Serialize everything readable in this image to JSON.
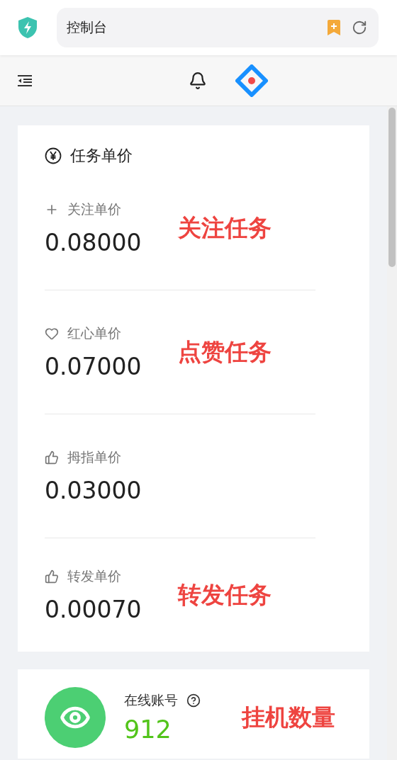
{
  "browser": {
    "address": "控制台"
  },
  "price_card": {
    "title": "任务单价",
    "items": [
      {
        "kind": "plus",
        "label": "关注单价",
        "value": "0.08000",
        "note": "关注任务"
      },
      {
        "kind": "heart",
        "label": "红心单价",
        "value": "0.07000",
        "note": "点赞任务"
      },
      {
        "kind": "thumb",
        "label": "拇指单价",
        "value": "0.03000"
      },
      {
        "kind": "thumb",
        "label": "转发单价",
        "value": "0.00070",
        "note": "转发任务"
      }
    ]
  },
  "online_card": {
    "label": "在线账号",
    "value": "912",
    "note": "挂机数量"
  }
}
